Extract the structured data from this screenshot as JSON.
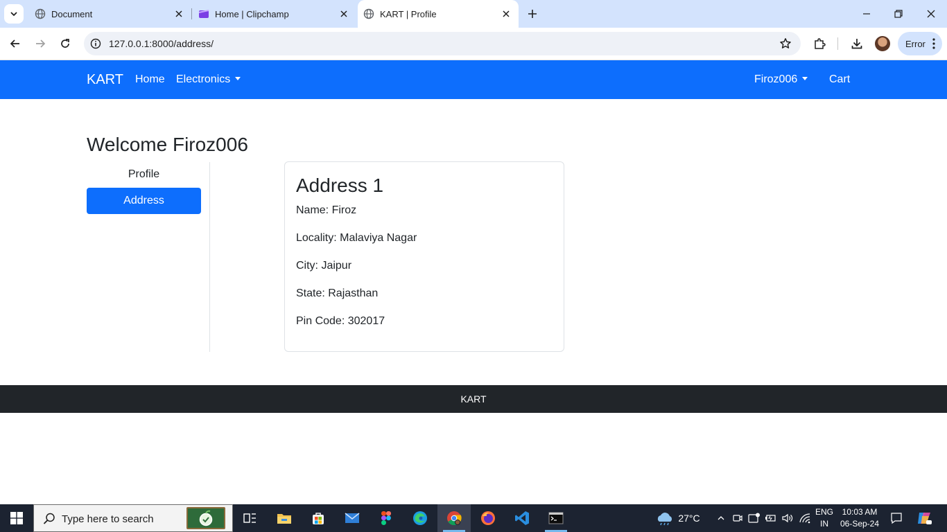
{
  "browser": {
    "tabs": [
      {
        "title": "Document",
        "icon": "globe-icon"
      },
      {
        "title": "Home | Clipchamp",
        "icon": "clipchamp-icon"
      },
      {
        "title": "KART | Profile",
        "icon": "globe-icon",
        "active": true
      }
    ],
    "url": "127.0.0.1:8000/address/",
    "profile_status": "Error"
  },
  "navbar": {
    "brand": "KART",
    "links": [
      "Home",
      "Electronics"
    ],
    "user_menu": "Firoz006",
    "cart": "Cart",
    "color": "#0d6efd"
  },
  "page": {
    "welcome": "Welcome Firoz006",
    "sidebar": {
      "profile": "Profile",
      "address": "Address",
      "active": "Address"
    },
    "address_card": {
      "title": "Address 1",
      "fields": [
        {
          "label": "Name: ",
          "value": "Firoz"
        },
        {
          "label": "Locality: ",
          "value": "Malaviya Nagar"
        },
        {
          "label": "City: ",
          "value": "Jaipur"
        },
        {
          "label": "State: ",
          "value": "Rajasthan"
        },
        {
          "label": "Pin Code: ",
          "value": "302017"
        }
      ]
    }
  },
  "footer": {
    "text": "KART"
  },
  "taskbar": {
    "search_placeholder": "Type here to search",
    "apps": [
      "task-view-icon",
      "file-explorer-icon",
      "store-icon",
      "mail-icon",
      "figma-icon",
      "edge-icon",
      "chrome-icon",
      "firefox-icon",
      "vscode-icon",
      "terminal-icon"
    ],
    "weather": "27°C",
    "language_top": "ENG",
    "language_bottom": "IN",
    "time": "10:03 AM",
    "date": "06-Sep-24"
  }
}
